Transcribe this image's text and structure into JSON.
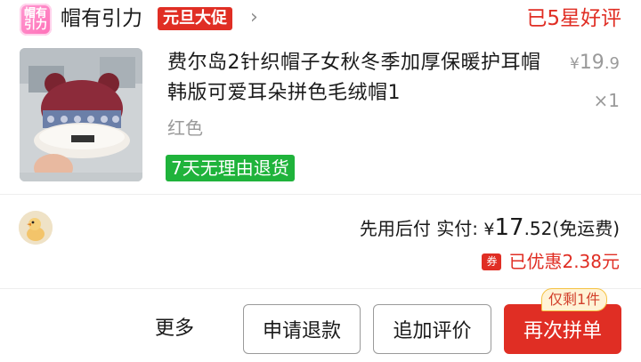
{
  "header": {
    "store_logo_text": "帽有引力",
    "store_name": "帽有引力",
    "promo_badge": "元旦大促",
    "order_status": "已5星好评"
  },
  "product": {
    "title": "费尔岛2针织帽子女秋冬季加厚保暖护耳帽韩版可爱耳朵拼色毛绒帽1",
    "price_currency": "¥",
    "price_int": "19",
    "price_dec": ".9",
    "quantity": "×1",
    "spec": "红色",
    "return_policy": "7天无理由退货"
  },
  "payment": {
    "method": "先用后付",
    "paid_label": "实付:",
    "currency": "¥",
    "amount_int": "17",
    "amount_dec": ".52",
    "shipping_note": "(免运费)",
    "coupon_icon_text": "券",
    "discount": "已优惠2.38元"
  },
  "actions": {
    "more": "更多",
    "refund": "申请退款",
    "review": "追加评价",
    "reorder": "再次拼单",
    "stock_badge": "仅剩1件"
  },
  "colors": {
    "accent_red": "#e02e24",
    "return_green": "#1fb33b",
    "muted_gray": "#9a9a9a"
  },
  "icons": {
    "promo_chevron": "chevron-right-icon",
    "coupon": "coupon-icon",
    "avatar": "duck-avatar-icon"
  }
}
